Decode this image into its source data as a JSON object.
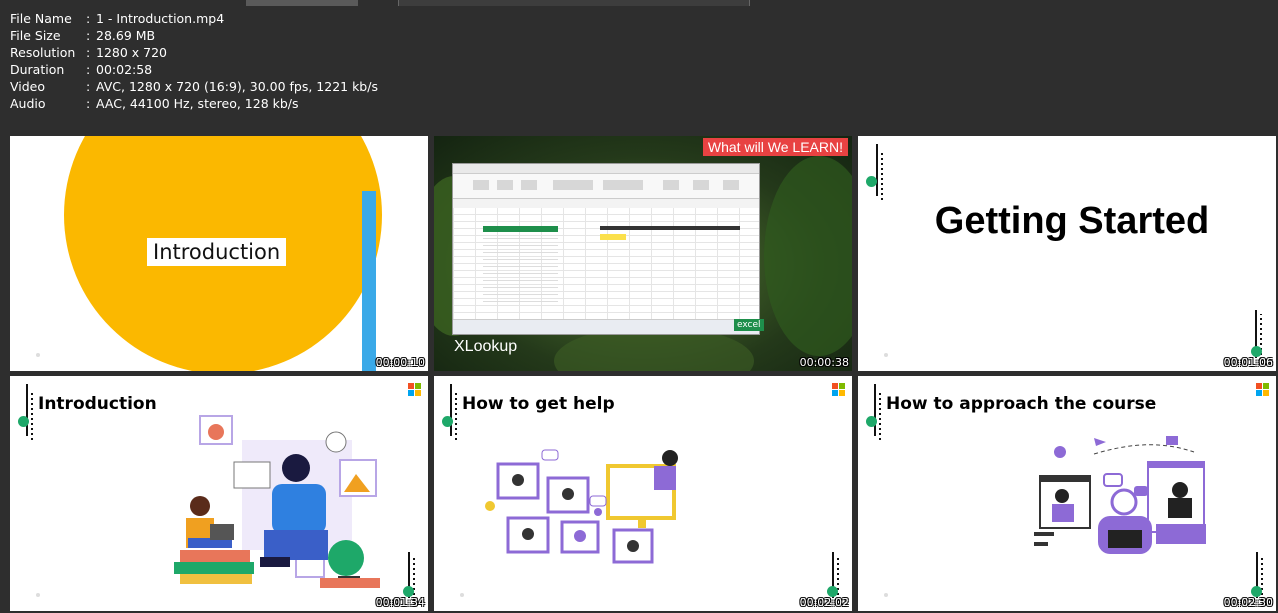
{
  "info": [
    {
      "key": "File Name",
      "sep": ":",
      "value": "1 - Introduction.mp4"
    },
    {
      "key": "File Size",
      "sep": ":",
      "value": "28.69 MB"
    },
    {
      "key": "Resolution",
      "sep": ":",
      "value": "1280 x 720"
    },
    {
      "key": "Duration",
      "sep": ":",
      "value": "00:02:58"
    },
    {
      "key": "Video",
      "sep": ":",
      "value": "AVC, 1280 x 720 (16:9), 30.00 fps, 1221 kb/s"
    },
    {
      "key": "Audio",
      "sep": ":",
      "value": "AAC, 44100 Hz, stereo, 128 kb/s"
    }
  ],
  "thumbnails": [
    {
      "label": "Introduction",
      "timestamp": "00:00:10"
    },
    {
      "label": "XLookup",
      "badge": "What will We LEARN!",
      "app_tag": "excel",
      "timestamp": "00:00:38"
    },
    {
      "label": "Getting Started",
      "timestamp": "00:01:06"
    },
    {
      "label": "Introduction",
      "timestamp": "00:01:34"
    },
    {
      "label": "How to get help",
      "timestamp": "00:02:02"
    },
    {
      "label": "How to approach the course",
      "timestamp": "00:02:30"
    }
  ],
  "colors": {
    "background": "#2e2e2e",
    "intro_yellow": "#fbb800",
    "intro_blue": "#3aa9e8",
    "accent_green": "#1ea869",
    "illustration_purple": "#8d6ad6",
    "badge_red": "#e84242"
  },
  "icons": [
    "microsoft-logo-icon",
    "excel-sheet-icon"
  ]
}
